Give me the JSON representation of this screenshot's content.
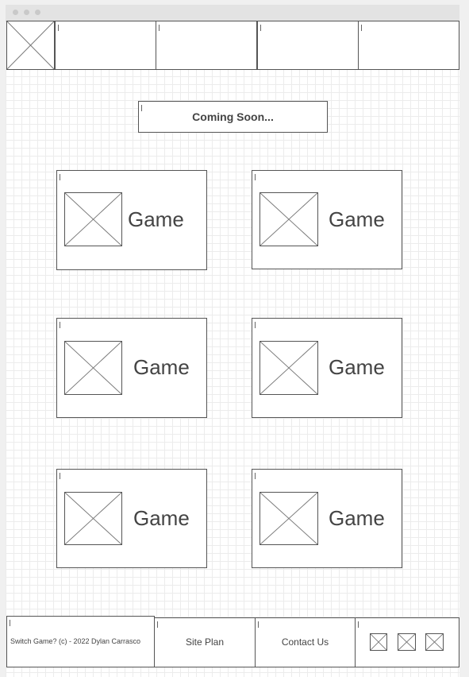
{
  "content": {
    "banner_text": "Coming Soon...",
    "game_cards": [
      {
        "label": "Game"
      },
      {
        "label": "Game"
      },
      {
        "label": "Game"
      },
      {
        "label": "Game"
      },
      {
        "label": "Game"
      },
      {
        "label": "Game"
      }
    ]
  },
  "footer": {
    "copyright": "Switch Game? (c) - 2022 Dylan Carrasco",
    "site_plan": "Site Plan",
    "contact": "Contact Us"
  },
  "icons": {
    "header_logo": "image-placeholder-icon",
    "game_image": "image-placeholder-icon",
    "social": [
      "image-placeholder-icon",
      "image-placeholder-icon",
      "image-placeholder-icon"
    ]
  },
  "colors": {
    "border": "#555555",
    "grid": "#ececec",
    "text": "#444444"
  }
}
